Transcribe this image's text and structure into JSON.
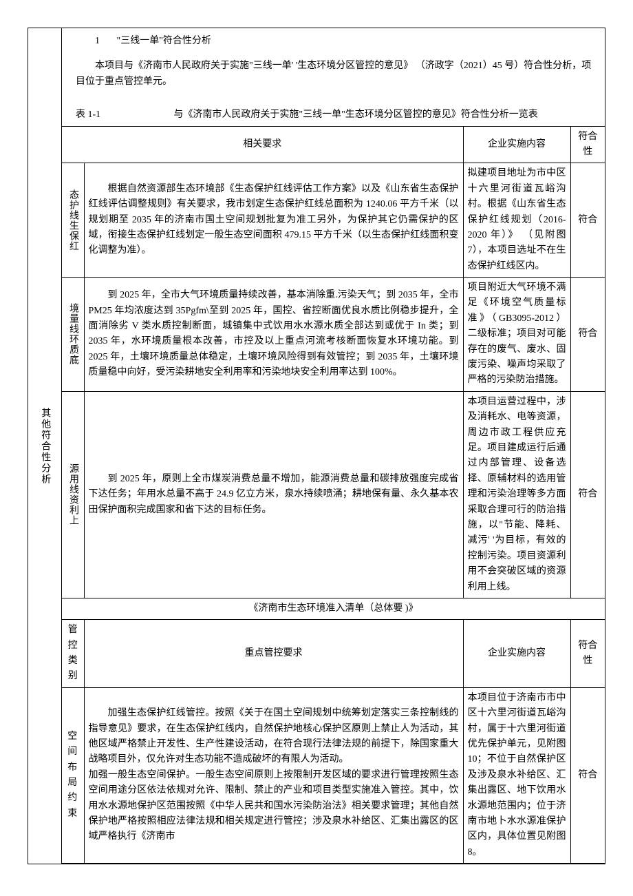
{
  "sideLabel": "其他符合性分析",
  "section": {
    "num": "1",
    "title": "\"三线一单\"符合性分析"
  },
  "intro": "本项目与《济南市人民政府关于实施\"三线一单'  '生态环境分区管控的意见》              （济政字（2021）45 号）符合性分析，项目位于重点管控单元。",
  "tableLabel": "表 1-1",
  "tableTitle": "与《济南市人民政府关于实施\"三线一单\"生态环境分区管控的意见》符合性分析一览表",
  "headers": {
    "req": "相关要求",
    "imp": "企业实施内容",
    "fit": "符合性",
    "ctrlCat": "管控类别",
    "keyReq": "重点管控要求"
  },
  "subHeader": "《济南市生态环境准入清单（总体要 )》",
  "rows1": [
    {
      "cat": "态护线生保红",
      "req": "根据自然资源部生态环境部《生态保护红线评估工作方案》以及《山东省生态保护红线评估调整规则》有关要求，我市划定生态保护红线总面积为 1240.06 平方千米（以规划期至 2035 年的济南市国土空间规划批复为准工另外，为保护其它仍需保护的区域，衔接生态保护红线划定一般生态空间面积 479.15 平方千米（以生态保护红线面积变化调整为准）。",
      "imp": "拟建项目地址为市中区十六里河街道瓦峪沟村。根据《山东省生态保护红线规划（2016-2020 年）》  （见附图7），本项目选址不在生态保护红线区内。",
      "fit": "符合"
    },
    {
      "cat": "境量线环质底",
      "req": "到 2025 年，全市大气环境质量持续改善，基本消除重.污染天气；到 2035 年，全市 PM25 年均浓度达到 35Pgfm\\至到 2025 年，国控、省控断面优良水质比例稳步提升，全面消除劣 V 类水质控制断面，城镇集中式饮用水水源水质全部达到或优于 In 类；到 2035 年，水环境质量根本改善，市控及以上重点河流考核断面恢复水环境功能。到 2025 年，土壤环境质量总体稳定，土壤环境风险得到有效管控；到 2035 年，土壤环境质量稳中向好，受污染耕地安全利用率和污染地块安全利用率达到 100%。",
      "imp": "项目附近大气环境不满足《环境空气质量标准》（GB3095-2012）二级标准；项目对可能存在的废气、废水、固废污染、噪声均采取了严格的污染防治措施。",
      "fit": "符合"
    },
    {
      "cat": "源用线资利上",
      "req": "到 2025 年，原则上全市煤炭消费总量不增加，能源消费总量和碳排放强度完成省下达任务；年用水总量不高于 24.9 亿立方米，泉水持续喷涌；耕地保有量、永久基本农田保护面积完成国家和省下达的目标任务。",
      "imp": "本项目运营过程中，涉及消耗水、电等资源，周边市政工程供应充足。项目建成运行后通过内部管理、设备选择、原辅材料的选用管理和污染治理等多方面采取合理可行的防治措施，以\"节能、降耗、减污' '为目标，有效的控制污染。项目资源利用不会突破区域的资源利用上线。",
      "fit": "符合"
    }
  ],
  "rows2": [
    {
      "cat": "空间布局约束",
      "req": "加强生态保护红线管控。按照《关于在国土空间规划中统筹划定落实三条控制线的指导意见》要求，在生态保护红线内，自然保护地核心保护区原则上禁止人为活动，其他区域严格禁止开发性、生产性建设活动，在符合现行法律法规的前提下，除国家重大战略项目外，仅允许对生态功能不造成破坏的有限人为活动。\n加强一般生态空间保护。一般生态空间原则上按限制开发区域的要求进行管理按照生态空间用途分区依法依规对允许、限制、禁止的产业和项目类型实施准入管控。其中，饮用水水源地保护区范围按照《中华人民共和国水污染防治法》相关要求管理；其他自然保护地严格按照相应法律法规和相关规定进行管控；涉及泉水补给区、汇集出露区的区域严格执行《济南市",
      "imp": "本项目位于济南市市中区十六里河街道瓦峪沟村，属于十六里河街道优先保护单元，见附图 10；不位于自然保护区及涉及泉水补给区、汇集出露区、地下饮用水水源地范围内；位于济南市地卜水水源准保护区内，具体位置见附图 8。",
      "fit": "符合"
    }
  ]
}
